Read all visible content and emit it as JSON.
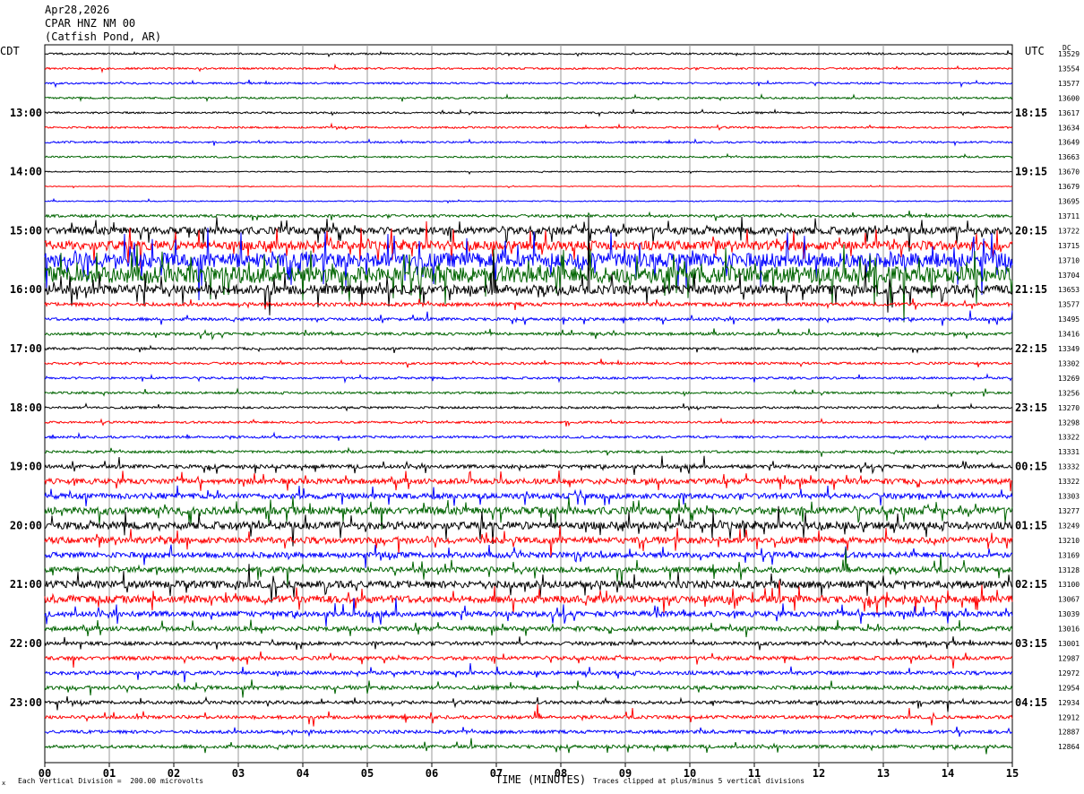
{
  "header": {
    "date": "Apr28,2026",
    "station": "CPAR HNZ NM 00",
    "location": "(Catfish Pond, AR)"
  },
  "labels": {
    "left_tz": "CDT",
    "right_tz": "UTC",
    "dc": "DC",
    "xlabel": "TIME (MINUTES)",
    "scale_note": "Each Vertical Division =  200.00 microvolts",
    "clip_note": "Traces clipped at plus/minus 5 vertical divisions",
    "corner_mark": "x"
  },
  "chart_data": {
    "type": "line",
    "xlabel": "TIME (MINUTES)",
    "xlim": [
      0,
      15
    ],
    "x_ticks": [
      "00",
      "01",
      "02",
      "03",
      "04",
      "05",
      "06",
      "07",
      "08",
      "09",
      "10",
      "11",
      "12",
      "13",
      "14",
      "15"
    ],
    "trace_colors": [
      "#000000",
      "#ff0000",
      "#0000ff",
      "#006400"
    ],
    "left_time_labels": [
      "13:00",
      "14:00",
      "15:00",
      "16:00",
      "17:00",
      "18:00",
      "19:00",
      "20:00",
      "21:00",
      "22:00",
      "23:00"
    ],
    "right_time_labels": [
      "18:15",
      "19:15",
      "20:15",
      "21:15",
      "22:15",
      "23:15",
      "00:15",
      "01:15",
      "02:15",
      "03:15",
      "04:15"
    ],
    "dc_offsets": [
      13529,
      13554,
      13577,
      13600,
      13617,
      13634,
      13649,
      13663,
      13670,
      13679,
      13695,
      13711,
      13722,
      13715,
      13710,
      13704,
      13653,
      13577,
      13495,
      13416,
      13349,
      13302,
      13269,
      13256,
      13270,
      13298,
      13322,
      13331,
      13332,
      13322,
      13303,
      13277,
      13249,
      13210,
      13169,
      13128,
      13100,
      13067,
      13039,
      13016,
      13001,
      12987,
      12972,
      12954,
      12934,
      12912,
      12887,
      12864
    ],
    "noise_level": [
      1,
      1,
      1,
      1,
      1,
      1,
      1,
      1,
      0.6,
      0.4,
      0.6,
      1.5,
      4,
      5,
      8,
      9,
      5,
      2,
      1.6,
      1.6,
      1.3,
      1.3,
      1.2,
      1.2,
      1.2,
      1.2,
      1.3,
      1.4,
      2,
      3,
      3,
      4,
      4,
      3.5,
      3,
      3,
      4,
      4,
      3,
      2.5,
      2,
      2,
      2,
      2,
      1.8,
      1.8,
      1.8,
      1.8
    ]
  }
}
